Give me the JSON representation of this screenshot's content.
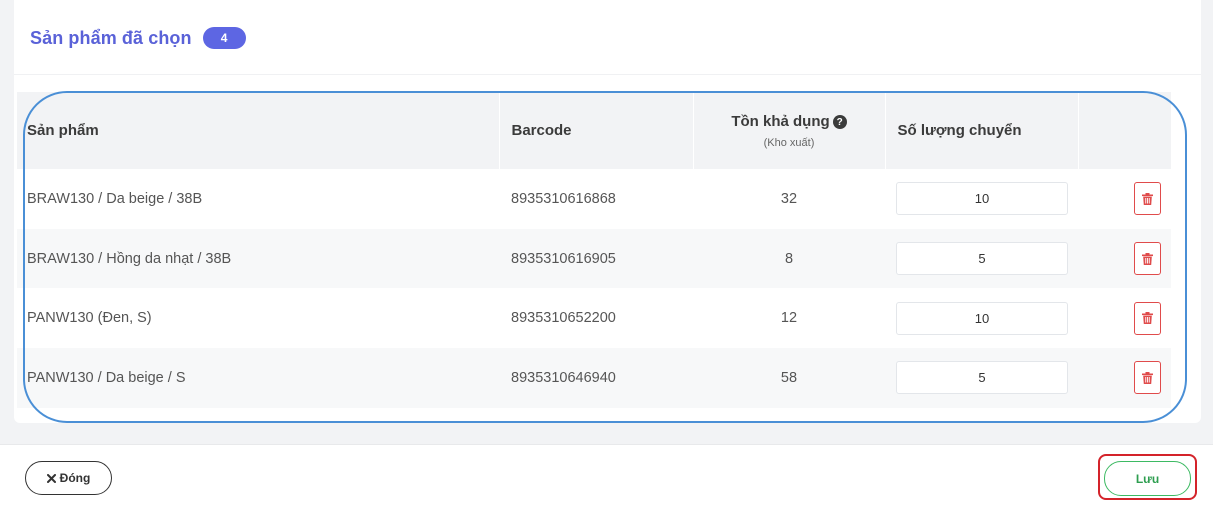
{
  "card": {
    "title": "Sản phẩm đã chọn",
    "count": "4"
  },
  "table": {
    "headers": {
      "product": "Sản phẩm",
      "barcode": "Barcode",
      "stock": "Tồn khả dụng",
      "stock_sub": "(Kho xuất)",
      "qty": "Số lượng chuyển"
    },
    "rows": [
      {
        "product": "BRAW130 / Da beige / 38B",
        "barcode": "8935310616868",
        "stock": "32",
        "qty": "10"
      },
      {
        "product": "BRAW130 / Hồng da nhạt / 38B",
        "barcode": "8935310616905",
        "stock": "8",
        "qty": "5"
      },
      {
        "product": "PANW130 (Đen, S)",
        "barcode": "8935310652200",
        "stock": "12",
        "qty": "10"
      },
      {
        "product": "PANW130 / Da beige / S",
        "barcode": "8935310646940",
        "stock": "58",
        "qty": "5"
      }
    ]
  },
  "footer": {
    "close_label": "Đóng",
    "save_label": "Lưu"
  },
  "icons": {
    "help": "question-circle-icon",
    "delete": "trash-icon",
    "close": "x-icon"
  },
  "colors": {
    "accent": "#5d66e3",
    "danger": "#e04b4b",
    "success": "#3dba63",
    "annotation_oval": "#4a8fd6",
    "annotation_box": "#d4232a"
  }
}
